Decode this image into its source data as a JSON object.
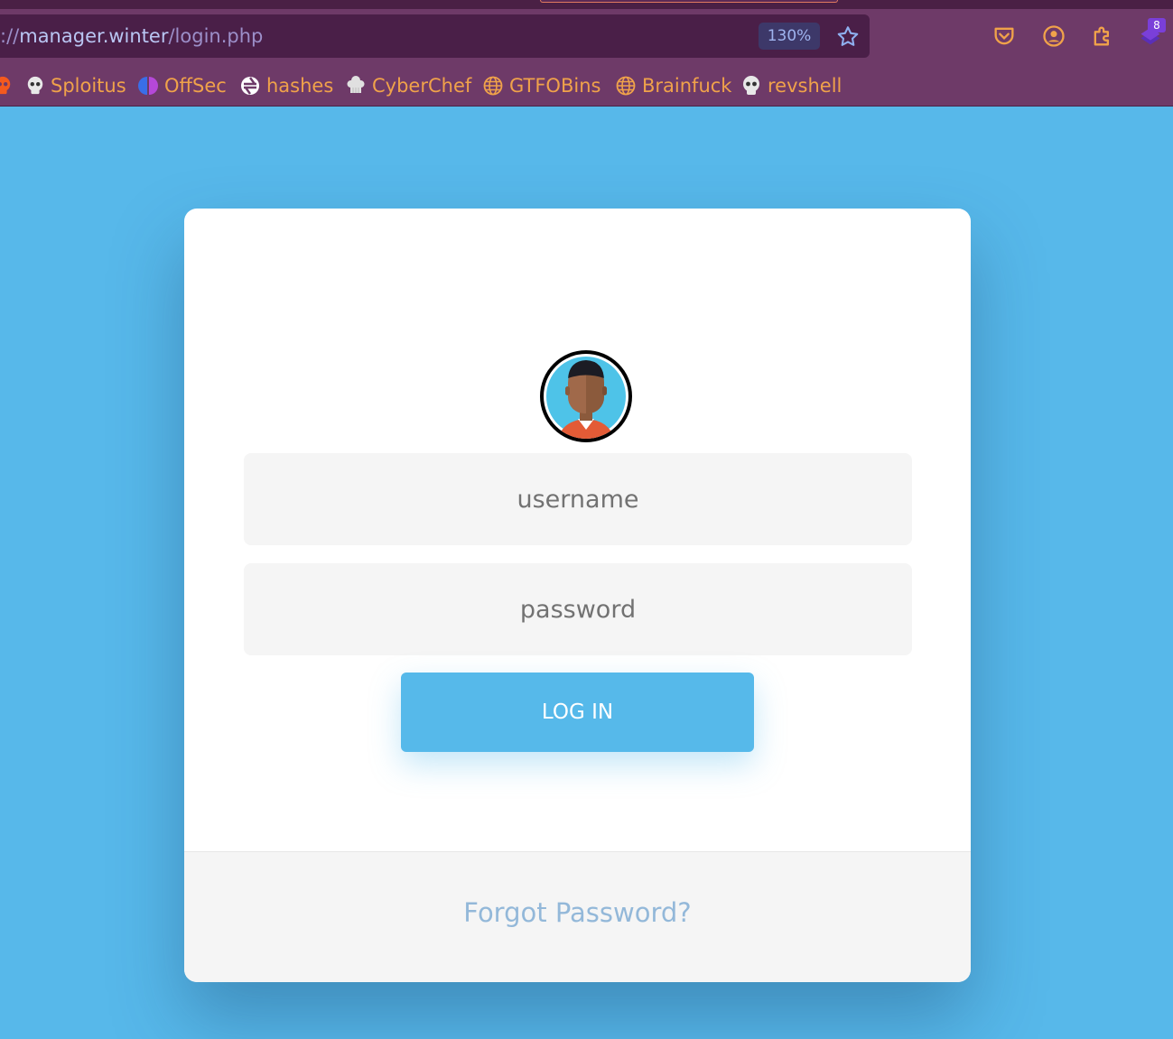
{
  "browser": {
    "url": {
      "scheme": "://",
      "host": "manager.winter",
      "path": "/login.php"
    },
    "zoom": "130%",
    "extension_badge": "8",
    "bookmarks": [
      {
        "label": "Sploitus",
        "icon": "skull-icon"
      },
      {
        "label": "OffSec",
        "icon": "offsec-icon"
      },
      {
        "label": "hashes",
        "icon": "hashes-icon"
      },
      {
        "label": "CyberChef",
        "icon": "chef-hat-icon"
      },
      {
        "label": "GTFOBins",
        "icon": "globe-icon"
      },
      {
        "label": "Brainfuck",
        "icon": "globe-icon"
      },
      {
        "label": "revshell",
        "icon": "skull-icon"
      }
    ]
  },
  "login": {
    "username_placeholder": "username",
    "password_placeholder": "password",
    "submit_label": "LOG IN",
    "forgot_label": "Forgot Password?"
  },
  "colors": {
    "page_background": "#57b8ea",
    "chrome": "#6e3a68",
    "button": "#56b9ea",
    "forgot_link": "#93b8d9",
    "bookmark_text": "#f0a24a"
  }
}
